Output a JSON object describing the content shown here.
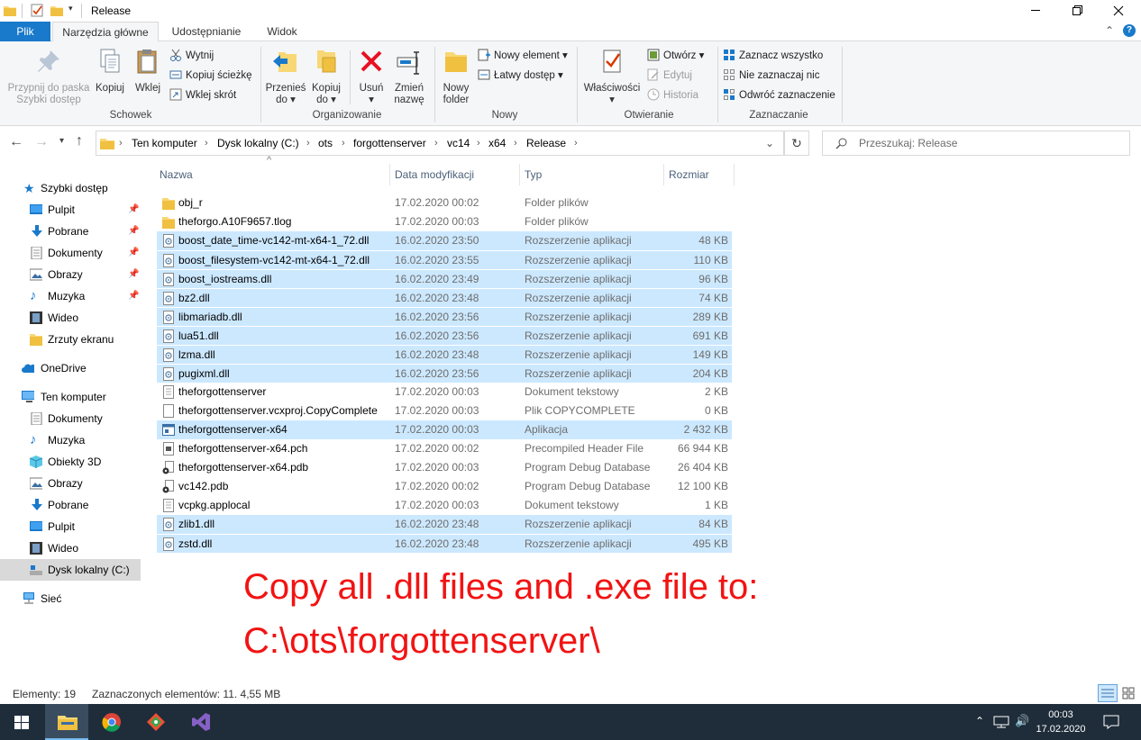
{
  "window": {
    "title": "Release",
    "qat_dropdown_icon": "chevron-down-icon"
  },
  "ribbon_tabs": [
    {
      "label": "Plik",
      "active": false,
      "file_tab": true
    },
    {
      "label": "Narzędzia główne",
      "active": true
    },
    {
      "label": "Udostępnianie",
      "active": false
    },
    {
      "label": "Widok",
      "active": false
    }
  ],
  "ribbon": {
    "schowek": {
      "label": "Schowek",
      "pin_label_1": "Przypnij do paska",
      "pin_label_2": "Szybki dostęp",
      "copy": "Kopiuj",
      "paste": "Wklej",
      "cut": "Wytnij",
      "copy_path": "Kopiuj ścieżkę",
      "paste_shortcut": "Wklej skrót"
    },
    "organizowanie": {
      "label": "Organizowanie",
      "move_to_1": "Przenieś",
      "move_to_2": "do ▾",
      "copy_to_1": "Kopiuj",
      "copy_to_2": "do ▾",
      "delete_1": "Usuń",
      "delete_2": "▾",
      "rename_1": "Zmień",
      "rename_2": "nazwę"
    },
    "nowy": {
      "label": "Nowy",
      "new_folder_1": "Nowy",
      "new_folder_2": "folder",
      "new_item": "Nowy element ▾",
      "easy_access": "Łatwy dostęp ▾"
    },
    "otwieranie": {
      "label": "Otwieranie",
      "properties_1": "Właściwości",
      "properties_2": "▾",
      "open": "Otwórz ▾",
      "edit": "Edytuj",
      "history": "Historia"
    },
    "zaznaczanie": {
      "label": "Zaznaczanie",
      "select_all": "Zaznacz wszystko",
      "select_none": "Nie zaznaczaj nic",
      "invert": "Odwróć zaznaczenie"
    }
  },
  "address": {
    "breadcrumbs": [
      "Ten komputer",
      "Dysk lokalny (C:)",
      "ots",
      "forgottenserver",
      "vc14",
      "x64",
      "Release"
    ],
    "search_placeholder": "Przeszukaj: Release"
  },
  "nav": {
    "quick_access": "Szybki dostęp",
    "quick_items": [
      {
        "label": "Pulpit",
        "icon": "desktop-icon",
        "pinned": true
      },
      {
        "label": "Pobrane",
        "icon": "downloads-icon",
        "pinned": true
      },
      {
        "label": "Dokumenty",
        "icon": "documents-icon",
        "pinned": true
      },
      {
        "label": "Obrazy",
        "icon": "pictures-icon",
        "pinned": true
      },
      {
        "label": "Muzyka",
        "icon": "music-icon",
        "pinned": true
      },
      {
        "label": "Wideo",
        "icon": "video-icon",
        "pinned": false
      },
      {
        "label": "Zrzuty ekranu",
        "icon": "folder-icon",
        "pinned": false
      }
    ],
    "onedrive": "OneDrive",
    "this_pc": "Ten komputer",
    "pc_items": [
      {
        "label": "Dokumenty",
        "icon": "documents-icon"
      },
      {
        "label": "Muzyka",
        "icon": "music-icon"
      },
      {
        "label": "Obiekty 3D",
        "icon": "3d-objects-icon"
      },
      {
        "label": "Obrazy",
        "icon": "pictures-icon"
      },
      {
        "label": "Pobrane",
        "icon": "downloads-icon"
      },
      {
        "label": "Pulpit",
        "icon": "desktop-icon"
      },
      {
        "label": "Wideo",
        "icon": "video-icon"
      },
      {
        "label": "Dysk lokalny (C:)",
        "icon": "drive-icon",
        "selected": true
      }
    ],
    "network": "Sieć"
  },
  "columns": {
    "name": "Nazwa",
    "date": "Data modyfikacji",
    "type": "Typ",
    "size": "Rozmiar"
  },
  "files": [
    {
      "name": "obj_r",
      "date": "17.02.2020 00:02",
      "type": "Folder plików",
      "size": "",
      "icon": "folder-icon",
      "selected": false
    },
    {
      "name": "theforgo.A10F9657.tlog",
      "date": "17.02.2020 00:03",
      "type": "Folder plików",
      "size": "",
      "icon": "folder-icon",
      "selected": false
    },
    {
      "name": "boost_date_time-vc142-mt-x64-1_72.dll",
      "date": "16.02.2020 23:50",
      "type": "Rozszerzenie aplikacji",
      "size": "48 KB",
      "icon": "dll-icon",
      "selected": true
    },
    {
      "name": "boost_filesystem-vc142-mt-x64-1_72.dll",
      "date": "16.02.2020 23:55",
      "type": "Rozszerzenie aplikacji",
      "size": "110 KB",
      "icon": "dll-icon",
      "selected": true
    },
    {
      "name": "boost_iostreams.dll",
      "date": "16.02.2020 23:49",
      "type": "Rozszerzenie aplikacji",
      "size": "96 KB",
      "icon": "dll-icon",
      "selected": true
    },
    {
      "name": "bz2.dll",
      "date": "16.02.2020 23:48",
      "type": "Rozszerzenie aplikacji",
      "size": "74 KB",
      "icon": "dll-icon",
      "selected": true
    },
    {
      "name": "libmariadb.dll",
      "date": "16.02.2020 23:56",
      "type": "Rozszerzenie aplikacji",
      "size": "289 KB",
      "icon": "dll-icon",
      "selected": true
    },
    {
      "name": "lua51.dll",
      "date": "16.02.2020 23:56",
      "type": "Rozszerzenie aplikacji",
      "size": "691 KB",
      "icon": "dll-icon",
      "selected": true
    },
    {
      "name": "lzma.dll",
      "date": "16.02.2020 23:48",
      "type": "Rozszerzenie aplikacji",
      "size": "149 KB",
      "icon": "dll-icon",
      "selected": true
    },
    {
      "name": "pugixml.dll",
      "date": "16.02.2020 23:56",
      "type": "Rozszerzenie aplikacji",
      "size": "204 KB",
      "icon": "dll-icon",
      "selected": true
    },
    {
      "name": "theforgottenserver",
      "date": "17.02.2020 00:03",
      "type": "Dokument tekstowy",
      "size": "2 KB",
      "icon": "text-file-icon",
      "selected": false
    },
    {
      "name": "theforgottenserver.vcxproj.CopyComplete",
      "date": "17.02.2020 00:03",
      "type": "Plik COPYCOMPLETE",
      "size": "0 KB",
      "icon": "blank-file-icon",
      "selected": false
    },
    {
      "name": "theforgottenserver-x64",
      "date": "17.02.2020 00:03",
      "type": "Aplikacja",
      "size": "2 432 KB",
      "icon": "exe-icon",
      "selected": true
    },
    {
      "name": "theforgottenserver-x64.pch",
      "date": "17.02.2020 00:02",
      "type": "Precompiled Header File",
      "size": "66 944 KB",
      "icon": "pch-file-icon",
      "selected": false
    },
    {
      "name": "theforgottenserver-x64.pdb",
      "date": "17.02.2020 00:03",
      "type": "Program Debug Database",
      "size": "26 404 KB",
      "icon": "pdb-file-icon",
      "selected": false
    },
    {
      "name": "vc142.pdb",
      "date": "17.02.2020 00:02",
      "type": "Program Debug Database",
      "size": "12 100 KB",
      "icon": "pdb-file-icon",
      "selected": false
    },
    {
      "name": "vcpkg.applocal",
      "date": "17.02.2020 00:03",
      "type": "Dokument tekstowy",
      "size": "1 KB",
      "icon": "text-file-icon",
      "selected": false
    },
    {
      "name": "zlib1.dll",
      "date": "16.02.2020 23:48",
      "type": "Rozszerzenie aplikacji",
      "size": "84 KB",
      "icon": "dll-icon",
      "selected": true
    },
    {
      "name": "zstd.dll",
      "date": "16.02.2020 23:48",
      "type": "Rozszerzenie aplikacji",
      "size": "495 KB",
      "icon": "dll-icon",
      "selected": true
    }
  ],
  "annotation": {
    "line1": "Copy all .dll files and .exe file to:",
    "line2": "C:\\ots\\forgottenserver\\",
    "color": "#f21313"
  },
  "status": {
    "count": "Elementy: 19",
    "selection": "Zaznaczonych elementów: 11. 4,55 MB"
  },
  "taskbar": {
    "time": "00:03",
    "date": "17.02.2020",
    "apps": [
      "windows-start-icon",
      "file-explorer-icon",
      "chrome-icon",
      "git-icon",
      "visual-studio-icon"
    ]
  },
  "colors": {
    "selection": "#cce8ff",
    "accent": "#1979ca",
    "taskbar": "#1f2d3a"
  }
}
